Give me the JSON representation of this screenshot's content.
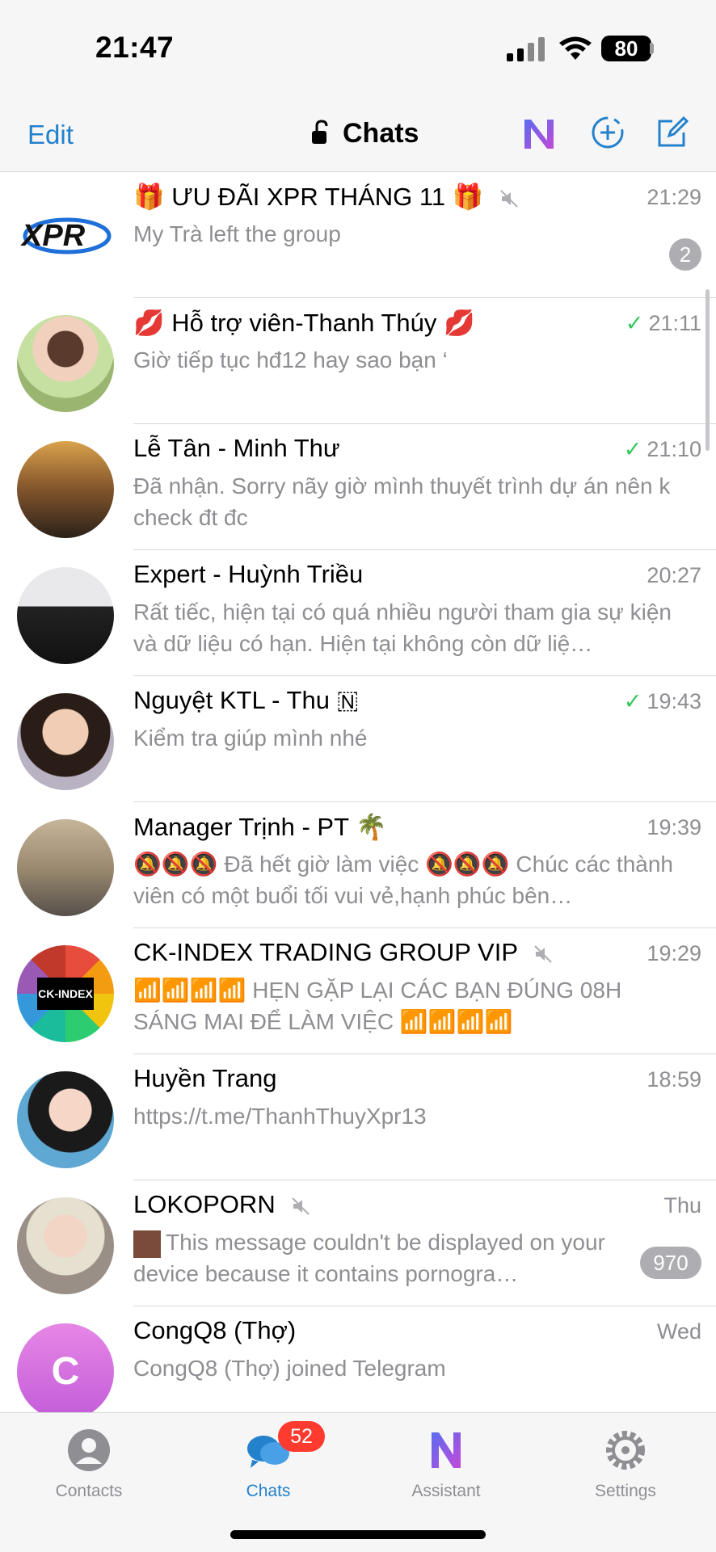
{
  "status": {
    "time": "21:47",
    "battery": "80"
  },
  "nav": {
    "edit": "Edit",
    "title": "Chats"
  },
  "chats": [
    {
      "name": "🎁 ƯU ĐÃI XPR THÁNG 11 🎁",
      "preview": "My Trà left the group",
      "time": "21:29",
      "badge": "2",
      "avatar": "xpr-logo"
    },
    {
      "name": "💋 Hỗ trợ viên-Thanh Thúy 💋",
      "preview": "Giờ tiếp tục hđ12 hay sao bạn ‘",
      "time": "21:11",
      "read": "✓"
    },
    {
      "name": "Lễ Tân - Minh Thư",
      "preview": "Đã nhận. Sorry nãy giờ mình thuyết trình dự án nên k check đt đc",
      "time": "21:10",
      "read": "✓"
    },
    {
      "name": "Expert - Huỳnh Triều",
      "preview": "Rất tiếc, hiện tại có quá nhiều người tham gia sự kiện và dữ liệu có hạn. Hiện tại không còn dữ liệ…",
      "time": "20:27"
    },
    {
      "name": "Nguyệt KTL - Thu 🇳",
      "preview": "Kiểm tra giúp mình nhé",
      "time": "19:43",
      "read": "✓"
    },
    {
      "name": "Manager Trịnh - PT 🌴",
      "preview": "🔕🔕🔕 Đã hết giờ làm việc 🔕🔕🔕 Chúc các thành viên có một buổi tối vui vẻ,hạnh phúc bên…",
      "time": "19:39"
    },
    {
      "name": "CK-INDEX TRADING GROUP VIP",
      "preview": "📶📶📶📶 HẸN GẶP LẠI CÁC BẠN ĐÚNG 08H SÁNG MAI ĐỂ LÀM VIỆC 📶📶📶📶",
      "time": "19:29",
      "avatar_text": "CK-INDEX"
    },
    {
      "name": "Huyền Trang",
      "preview": "https://t.me/ThanhThuyXpr13",
      "time": "18:59"
    },
    {
      "name": "LOKOPORN",
      "preview": "This message couldn't be displayed on your device because it contains pornogra…",
      "time": "Thu",
      "badge": "970"
    },
    {
      "name": "CongQ8 (Thợ)",
      "preview": "CongQ8 (Thợ) joined Telegram",
      "time": "Wed",
      "avatar_text": "C"
    }
  ],
  "tabs": [
    {
      "label": "Contacts"
    },
    {
      "label": "Chats",
      "badge": "52"
    },
    {
      "label": "Assistant"
    },
    {
      "label": "Settings"
    }
  ],
  "colors": {
    "accent": "#2481cc",
    "check": "#34c759",
    "badge_red": "#ff3b30",
    "muted_badge": "#aeaeb2"
  }
}
